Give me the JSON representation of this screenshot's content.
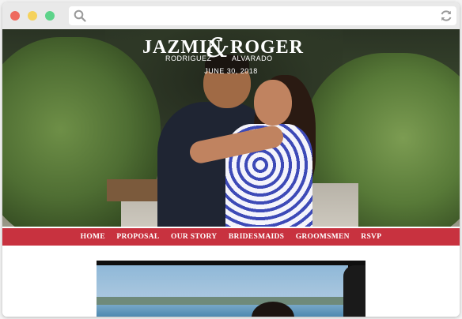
{
  "browser": {
    "window_controls": [
      "close",
      "minimize",
      "maximize"
    ],
    "url": "",
    "search_icon": "search-icon",
    "reload_icon": "reload-icon"
  },
  "hero": {
    "first_name_1": "JAZMIN",
    "ampersand": "&",
    "first_name_2": "ROGER",
    "surname_1": "RODRIGUEZ",
    "surname_2": "ALVARADO",
    "date": "JUNE 30, 2018"
  },
  "nav": {
    "items": [
      "HOME",
      "PROPOSAL",
      "OUR STORY",
      "BRIDESMAIDS",
      "GROOMSMEN",
      "RSVP"
    ]
  },
  "colors": {
    "nav_bg": "#c8323f",
    "chrome_bg": "#e9e9e9",
    "close": "#ee6a5f",
    "minimize": "#f5d25c",
    "maximize": "#5dd38a"
  }
}
